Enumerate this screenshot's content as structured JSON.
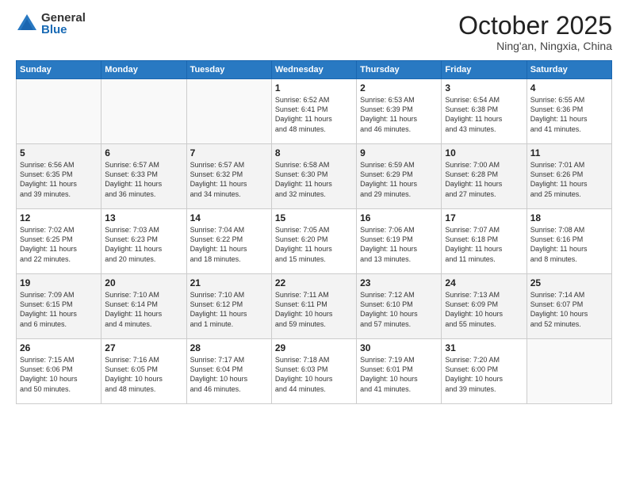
{
  "logo": {
    "general": "General",
    "blue": "Blue"
  },
  "title": "October 2025",
  "location": "Ning'an, Ningxia, China",
  "days_of_week": [
    "Sunday",
    "Monday",
    "Tuesday",
    "Wednesday",
    "Thursday",
    "Friday",
    "Saturday"
  ],
  "weeks": [
    [
      {
        "day": "",
        "info": ""
      },
      {
        "day": "",
        "info": ""
      },
      {
        "day": "",
        "info": ""
      },
      {
        "day": "1",
        "info": "Sunrise: 6:52 AM\nSunset: 6:41 PM\nDaylight: 11 hours\nand 48 minutes."
      },
      {
        "day": "2",
        "info": "Sunrise: 6:53 AM\nSunset: 6:39 PM\nDaylight: 11 hours\nand 46 minutes."
      },
      {
        "day": "3",
        "info": "Sunrise: 6:54 AM\nSunset: 6:38 PM\nDaylight: 11 hours\nand 43 minutes."
      },
      {
        "day": "4",
        "info": "Sunrise: 6:55 AM\nSunset: 6:36 PM\nDaylight: 11 hours\nand 41 minutes."
      }
    ],
    [
      {
        "day": "5",
        "info": "Sunrise: 6:56 AM\nSunset: 6:35 PM\nDaylight: 11 hours\nand 39 minutes."
      },
      {
        "day": "6",
        "info": "Sunrise: 6:57 AM\nSunset: 6:33 PM\nDaylight: 11 hours\nand 36 minutes."
      },
      {
        "day": "7",
        "info": "Sunrise: 6:57 AM\nSunset: 6:32 PM\nDaylight: 11 hours\nand 34 minutes."
      },
      {
        "day": "8",
        "info": "Sunrise: 6:58 AM\nSunset: 6:30 PM\nDaylight: 11 hours\nand 32 minutes."
      },
      {
        "day": "9",
        "info": "Sunrise: 6:59 AM\nSunset: 6:29 PM\nDaylight: 11 hours\nand 29 minutes."
      },
      {
        "day": "10",
        "info": "Sunrise: 7:00 AM\nSunset: 6:28 PM\nDaylight: 11 hours\nand 27 minutes."
      },
      {
        "day": "11",
        "info": "Sunrise: 7:01 AM\nSunset: 6:26 PM\nDaylight: 11 hours\nand 25 minutes."
      }
    ],
    [
      {
        "day": "12",
        "info": "Sunrise: 7:02 AM\nSunset: 6:25 PM\nDaylight: 11 hours\nand 22 minutes."
      },
      {
        "day": "13",
        "info": "Sunrise: 7:03 AM\nSunset: 6:23 PM\nDaylight: 11 hours\nand 20 minutes."
      },
      {
        "day": "14",
        "info": "Sunrise: 7:04 AM\nSunset: 6:22 PM\nDaylight: 11 hours\nand 18 minutes."
      },
      {
        "day": "15",
        "info": "Sunrise: 7:05 AM\nSunset: 6:20 PM\nDaylight: 11 hours\nand 15 minutes."
      },
      {
        "day": "16",
        "info": "Sunrise: 7:06 AM\nSunset: 6:19 PM\nDaylight: 11 hours\nand 13 minutes."
      },
      {
        "day": "17",
        "info": "Sunrise: 7:07 AM\nSunset: 6:18 PM\nDaylight: 11 hours\nand 11 minutes."
      },
      {
        "day": "18",
        "info": "Sunrise: 7:08 AM\nSunset: 6:16 PM\nDaylight: 11 hours\nand 8 minutes."
      }
    ],
    [
      {
        "day": "19",
        "info": "Sunrise: 7:09 AM\nSunset: 6:15 PM\nDaylight: 11 hours\nand 6 minutes."
      },
      {
        "day": "20",
        "info": "Sunrise: 7:10 AM\nSunset: 6:14 PM\nDaylight: 11 hours\nand 4 minutes."
      },
      {
        "day": "21",
        "info": "Sunrise: 7:10 AM\nSunset: 6:12 PM\nDaylight: 11 hours\nand 1 minute."
      },
      {
        "day": "22",
        "info": "Sunrise: 7:11 AM\nSunset: 6:11 PM\nDaylight: 10 hours\nand 59 minutes."
      },
      {
        "day": "23",
        "info": "Sunrise: 7:12 AM\nSunset: 6:10 PM\nDaylight: 10 hours\nand 57 minutes."
      },
      {
        "day": "24",
        "info": "Sunrise: 7:13 AM\nSunset: 6:09 PM\nDaylight: 10 hours\nand 55 minutes."
      },
      {
        "day": "25",
        "info": "Sunrise: 7:14 AM\nSunset: 6:07 PM\nDaylight: 10 hours\nand 52 minutes."
      }
    ],
    [
      {
        "day": "26",
        "info": "Sunrise: 7:15 AM\nSunset: 6:06 PM\nDaylight: 10 hours\nand 50 minutes."
      },
      {
        "day": "27",
        "info": "Sunrise: 7:16 AM\nSunset: 6:05 PM\nDaylight: 10 hours\nand 48 minutes."
      },
      {
        "day": "28",
        "info": "Sunrise: 7:17 AM\nSunset: 6:04 PM\nDaylight: 10 hours\nand 46 minutes."
      },
      {
        "day": "29",
        "info": "Sunrise: 7:18 AM\nSunset: 6:03 PM\nDaylight: 10 hours\nand 44 minutes."
      },
      {
        "day": "30",
        "info": "Sunrise: 7:19 AM\nSunset: 6:01 PM\nDaylight: 10 hours\nand 41 minutes."
      },
      {
        "day": "31",
        "info": "Sunrise: 7:20 AM\nSunset: 6:00 PM\nDaylight: 10 hours\nand 39 minutes."
      },
      {
        "day": "",
        "info": ""
      }
    ]
  ]
}
